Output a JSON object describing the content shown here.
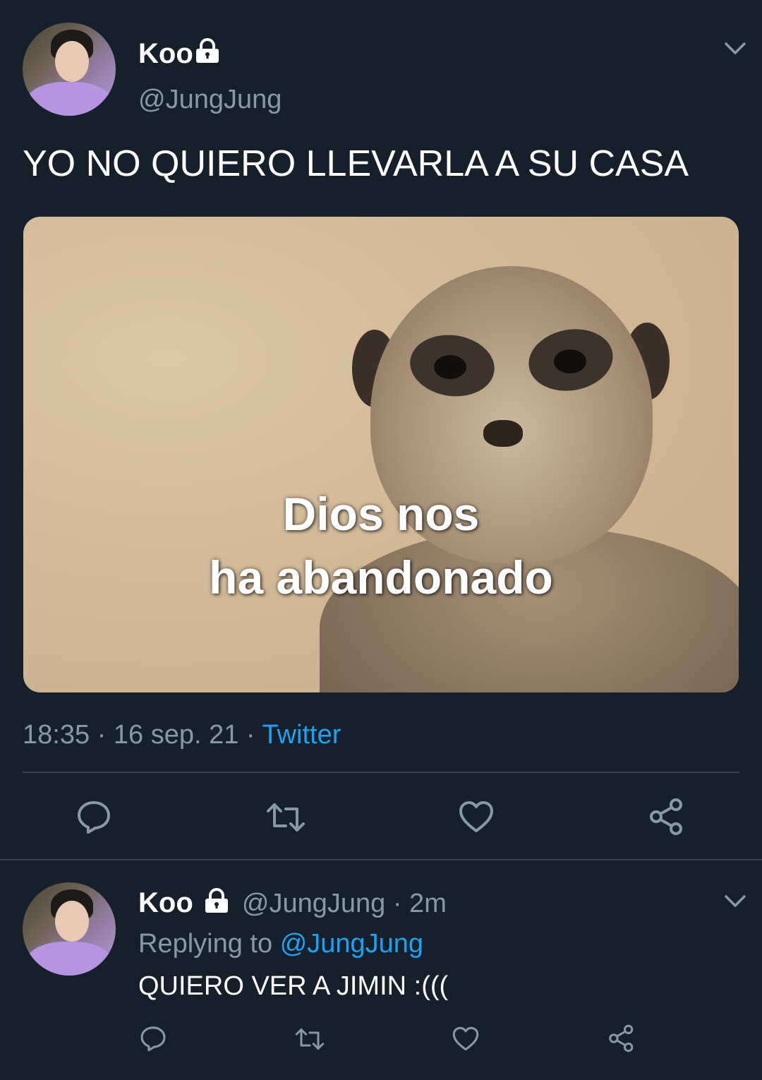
{
  "main_tweet": {
    "display_name": "Koo",
    "handle": "@JungJung",
    "text": "YO NO QUIERO LLEVARLA A SU CASA",
    "meme_caption_line1": "Dios nos",
    "meme_caption_line2": "ha abandonado",
    "time": "18:35",
    "sep": "·",
    "date": "16 sep. 21",
    "source": "Twitter"
  },
  "reply_tweet": {
    "display_name": "Koo",
    "handle": "@JungJung",
    "age": "· 2m",
    "replying_prefix": "Replying to",
    "replying_handle": "@JungJung",
    "text": "QUIERO VER A JIMIN :((("
  },
  "icons": {
    "lock": "lock-icon",
    "chevron": "chevron-down-icon",
    "reply": "reply-icon",
    "retweet": "retweet-icon",
    "like": "like-icon",
    "share": "share-icon"
  },
  "colors": {
    "background": "#15202b",
    "text": "#ffffff",
    "muted": "#8899a6",
    "link": "#1da1f2",
    "divider": "#38444d"
  }
}
